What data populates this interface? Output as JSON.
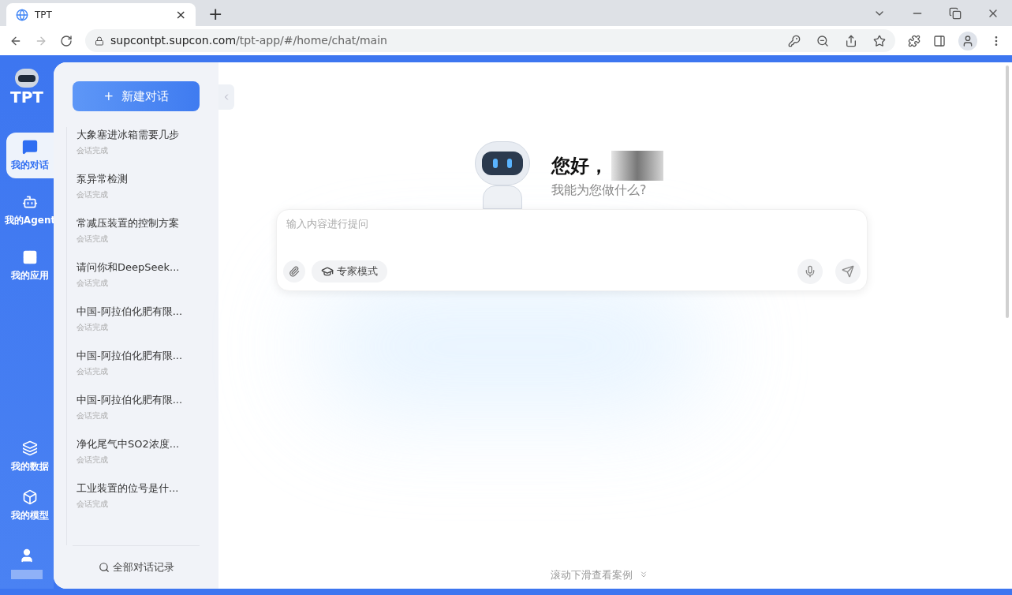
{
  "browser": {
    "tab_title": "TPT",
    "tab_close": "×",
    "new_tab": "+",
    "url_host": "supcontpt.supcon.com",
    "url_path": "/tpt-app/#/home/chat/main"
  },
  "logo": {
    "text": "TPT"
  },
  "nav_top": [
    {
      "label": "我的对话",
      "selected": true,
      "kind": "chat"
    },
    {
      "label": "我的Agent",
      "selected": false,
      "kind": "agent"
    },
    {
      "label": "我的应用",
      "selected": false,
      "kind": "apps"
    }
  ],
  "nav_bottom": [
    {
      "label": "我的数据",
      "selected": false,
      "kind": "data"
    },
    {
      "label": "我的模型",
      "selected": false,
      "kind": "model"
    }
  ],
  "new_chat_button": "+  新建对话",
  "conversations": [
    {
      "title": "大象塞进冰箱需要几步",
      "status": "会话完成"
    },
    {
      "title": "泵异常检测",
      "status": "会话完成"
    },
    {
      "title": "常减压装置的控制方案",
      "status": "会话完成"
    },
    {
      "title": "请问你和DeepSeek...",
      "status": "会话完成"
    },
    {
      "title": "中国-阿拉伯化肥有限...",
      "status": "会话完成"
    },
    {
      "title": "中国-阿拉伯化肥有限...",
      "status": "会话完成"
    },
    {
      "title": "中国-阿拉伯化肥有限...",
      "status": "会话完成"
    },
    {
      "title": "净化尾气中SO2浓度...",
      "status": "会话完成"
    },
    {
      "title": "工业装置的位号是什...",
      "status": "会话完成"
    }
  ],
  "all_history_link": "全部对话记录",
  "greeting": {
    "title": "您好，",
    "subtitle": "我能为您做什么?"
  },
  "composer": {
    "placeholder": "输入内容进行提问",
    "expert_mode": "专家模式"
  },
  "scroll_hint": "滚动下滑查看案例"
}
